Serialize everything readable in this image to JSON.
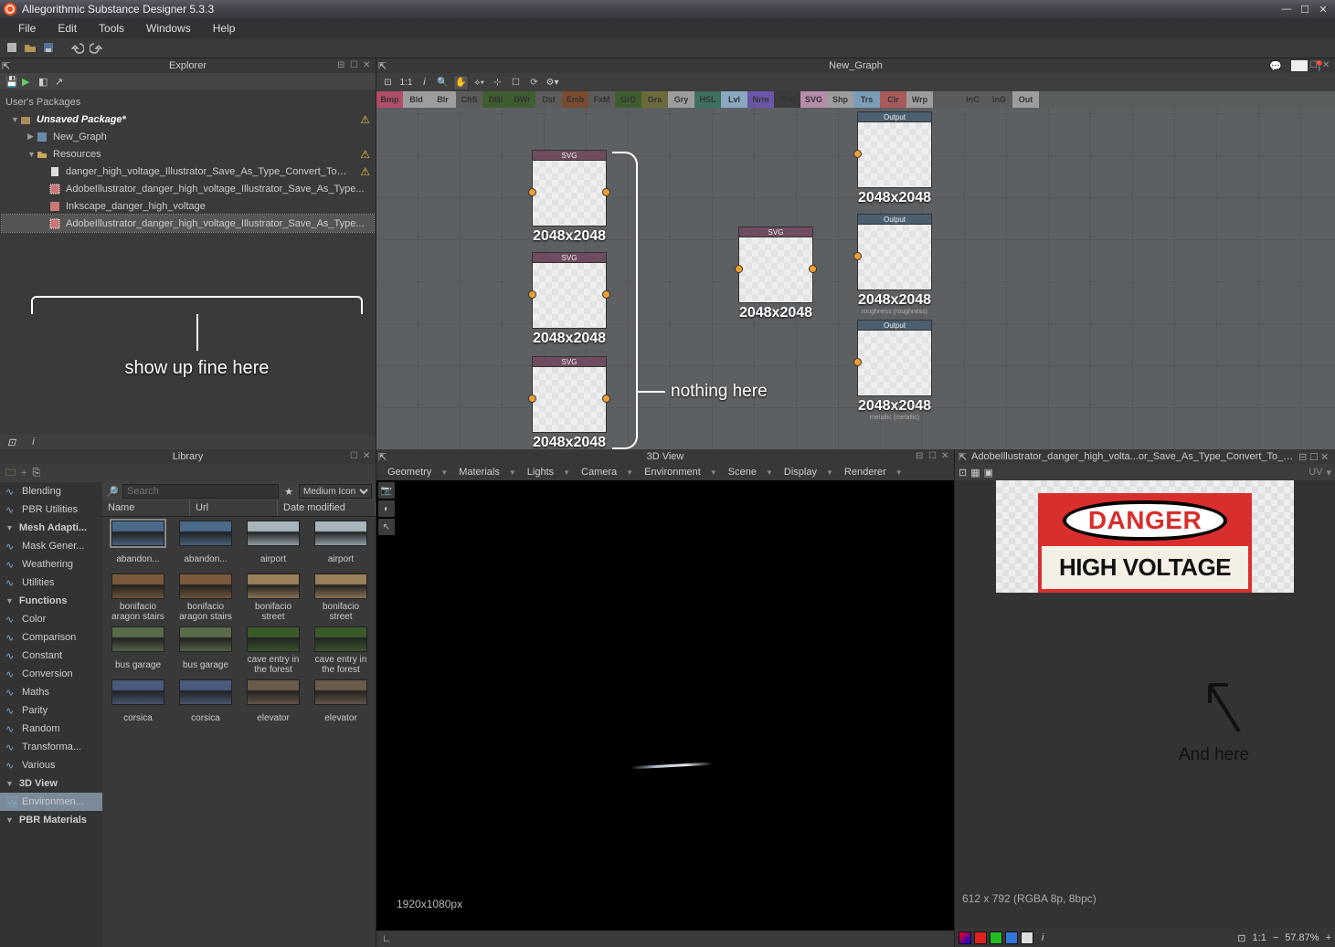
{
  "titlebar": {
    "title": "Allegorithmic Substance Designer 5.3.3"
  },
  "menu": [
    "File",
    "Edit",
    "Tools",
    "Windows",
    "Help"
  ],
  "panels": {
    "explorer": "Explorer",
    "library": "Library",
    "graph": "New_Graph",
    "view3d": "3D View",
    "view2d": "AdobeIllustrator_danger_high_volta...or_Save_As_Type_Convert_To_Outline"
  },
  "explorer": {
    "root": "User's Packages",
    "pkg": "Unsaved Package*",
    "graph": "New_Graph",
    "resFolder": "Resources",
    "items": [
      "danger_high_voltage_Illustrator_Save_As_Type_Convert_To_Out...",
      "AdobeIllustrator_danger_high_voltage_Illustrator_Save_As_Type...",
      "Inkscape_danger_high_voltage",
      "AdobeIllustrator_danger_high_voltage_Illustrator_Save_As_Type..."
    ],
    "annot": "show up fine here"
  },
  "nodebar": [
    {
      "l": "Bmp",
      "c": "#b14d67"
    },
    {
      "l": "Bld",
      "c": "#9d9d9d"
    },
    {
      "l": "Blr",
      "c": "#9d9d9d"
    },
    {
      "l": "ChS",
      "c": "#5b5b5b"
    },
    {
      "l": "DBl",
      "c": "#3e5e2f"
    },
    {
      "l": "DWr",
      "c": "#3e5e2f"
    },
    {
      "l": "Dst",
      "c": "#5b5b5b"
    },
    {
      "l": "Emb",
      "c": "#7a4b2e"
    },
    {
      "l": "FxM",
      "c": "#5b5b5b"
    },
    {
      "l": "GrD",
      "c": "#3e5e2f"
    },
    {
      "l": "Gra",
      "c": "#6a6a3a"
    },
    {
      "l": "Gry",
      "c": "#9d9d9d"
    },
    {
      "l": "HSL",
      "c": "#3e7060"
    },
    {
      "l": "Lvl",
      "c": "#8aa8c0"
    },
    {
      "l": "Nrm",
      "c": "#6a55a8"
    },
    {
      "l": "Pix",
      "c": "#3a3a3a"
    },
    {
      "l": "SVG",
      "c": "#b58caa"
    },
    {
      "l": "Shp",
      "c": "#9d9d9d"
    },
    {
      "l": "Trs",
      "c": "#7a9db8"
    },
    {
      "l": "Clr",
      "c": "#a85a5a"
    },
    {
      "l": "Wrp",
      "c": "#9d9d9d"
    },
    {
      "l": "",
      "c": "#5b5b5b"
    },
    {
      "l": "InC",
      "c": "#5b5b5b"
    },
    {
      "l": "InG",
      "c": "#5b5b5b"
    },
    {
      "l": "Out",
      "c": "#9d9d9d"
    }
  ],
  "graph": {
    "svgLabel": "SVG",
    "outLabel": "Output",
    "dim": "2048x2048",
    "annot1": "nothing here",
    "outSubs": [
      "",
      "roughness (roughness)",
      "metallic (metallic)",
      ""
    ]
  },
  "library": {
    "cats": [
      {
        "l": "Blending",
        "t": "i"
      },
      {
        "l": "PBR Utilities",
        "t": "i"
      },
      {
        "l": "Mesh Adapti...",
        "t": "h"
      },
      {
        "l": "Mask Gener...",
        "t": "i"
      },
      {
        "l": "Weathering",
        "t": "i"
      },
      {
        "l": "Utilities",
        "t": "i"
      },
      {
        "l": "Functions",
        "t": "h"
      },
      {
        "l": "Color",
        "t": "s"
      },
      {
        "l": "Comparison",
        "t": "s"
      },
      {
        "l": "Constant",
        "t": "s"
      },
      {
        "l": "Conversion",
        "t": "s"
      },
      {
        "l": "Maths",
        "t": "s"
      },
      {
        "l": "Parity",
        "t": "s"
      },
      {
        "l": "Random",
        "t": "s"
      },
      {
        "l": "Transforma...",
        "t": "s"
      },
      {
        "l": "Various",
        "t": "s"
      },
      {
        "l": "3D View",
        "t": "h"
      },
      {
        "l": "Environmen...",
        "t": "sel"
      },
      {
        "l": "PBR Materials",
        "t": "h"
      }
    ],
    "searchPH": "Search",
    "viewMode": "Medium Icon",
    "cols": [
      "Name",
      "Url",
      "Date modified"
    ],
    "thumbs": [
      [
        "abandon...",
        "abandon...",
        "airport",
        "airport"
      ],
      [
        "bonifacio aragon stairs",
        "bonifacio aragon stairs",
        "bonifacio street",
        "bonifacio street"
      ],
      [
        "bus garage",
        "bus garage",
        "cave entry in the forest",
        "cave entry in the forest"
      ],
      [
        "corsica",
        "corsica",
        "elevator",
        "elevator"
      ]
    ],
    "thumbColors": [
      [
        "#4a6a8c",
        "#4a6a8c",
        "#a8b4bc",
        "#a8b4bc"
      ],
      [
        "#7a5a3a",
        "#7a5a3a",
        "#9a805a",
        "#9a805a"
      ],
      [
        "#5a6a4a",
        "#5a6a4a",
        "#3a5a2a",
        "#3a5a2a"
      ],
      [
        "#4a5a7c",
        "#4a5a7c",
        "#6a5a4a",
        "#6a5a4a"
      ]
    ]
  },
  "view3d": {
    "menus": [
      "Geometry",
      "Materials",
      "Lights",
      "Camera",
      "Environment",
      "Scene",
      "Display",
      "Renderer"
    ],
    "res": "1920x1080px"
  },
  "view2d": {
    "danger": "DANGER",
    "hv": "HIGH VOLTAGE",
    "annot": "And here",
    "meta": "612 x 792 (RGBA 8p, 8bpc)",
    "uv": "UV",
    "ratio": "1:1",
    "zoom": "57.87%"
  }
}
